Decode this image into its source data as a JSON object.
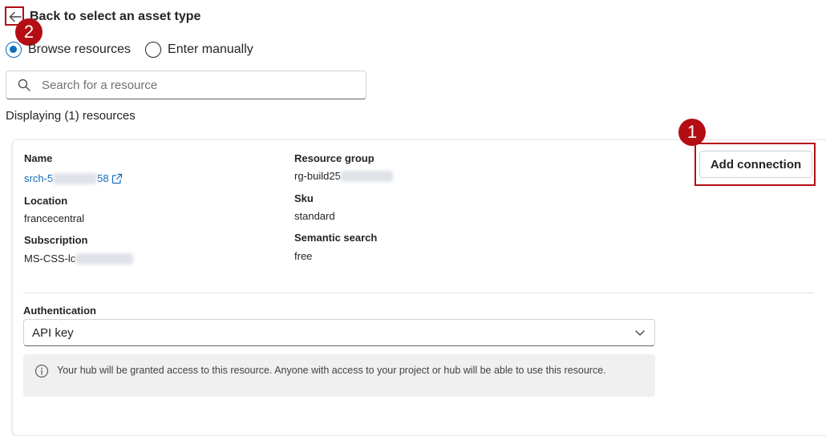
{
  "header": {
    "back_label": "Back to select an asset type"
  },
  "callouts": {
    "add_connection_number": "1",
    "back_number": "2"
  },
  "source_mode": {
    "options": [
      {
        "label": "Browse resources",
        "selected": true
      },
      {
        "label": "Enter manually",
        "selected": false
      }
    ]
  },
  "search": {
    "placeholder": "Search for a resource",
    "value": ""
  },
  "results_count_text": "Displaying (1) resources",
  "resource": {
    "name_label": "Name",
    "name_value_prefix": "srch-5",
    "name_value_suffix": "58",
    "location_label": "Location",
    "location_value": "francecentral",
    "subscription_label": "Subscription",
    "subscription_value_prefix": "MS-CSS-lc",
    "resource_group_label": "Resource group",
    "resource_group_prefix": "rg-build25",
    "sku_label": "Sku",
    "sku_value": "standard",
    "semantic_search_label": "Semantic search",
    "semantic_search_value": "free",
    "add_connection_label": "Add connection"
  },
  "authentication": {
    "label": "Authentication",
    "selected": "API key"
  },
  "info_message": "Your hub will be granted access to this resource. Anyone with access to your project or hub will be able to use this resource.",
  "colors": {
    "accent": "#0f6cbd",
    "callout": "#b40e14"
  },
  "icons": [
    "back-arrow-icon",
    "search-icon",
    "external-link-icon",
    "chevron-down-icon",
    "info-icon"
  ]
}
